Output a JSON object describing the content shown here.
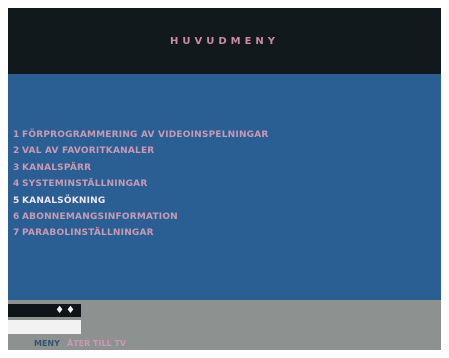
{
  "header": {
    "title": "HUVUDMENY"
  },
  "menu": {
    "items": [
      {
        "number": "1",
        "label": "FÖRPROGRAMMERING AV VIDEOINSPELNINGAR",
        "selected": false
      },
      {
        "number": "2",
        "label": "VAL AV FAVORITKANALER",
        "selected": false
      },
      {
        "number": "3",
        "label": "KANALSPÄRR",
        "selected": false
      },
      {
        "number": "4",
        "label": "SYSTEMINSTÄLLNINGAR",
        "selected": false
      },
      {
        "number": "5",
        "label": "KANALSÖKNING",
        "selected": true
      },
      {
        "number": "6",
        "label": "ABONNEMANGSINFORMATION",
        "selected": false
      },
      {
        "number": "7",
        "label": "PARABOLINSTÄLLNINGAR",
        "selected": false
      }
    ]
  },
  "footer": {
    "nav_arrows": "♦♦",
    "meny_key": "MENY",
    "meny_action": "ÅTER TILL TV"
  },
  "colors": {
    "menu_background": "#2a5f93",
    "header_background": "#12191d",
    "footer_background": "#8d9190",
    "text_pink": "#c99ab3",
    "text_selected": "#f0e6ef"
  }
}
